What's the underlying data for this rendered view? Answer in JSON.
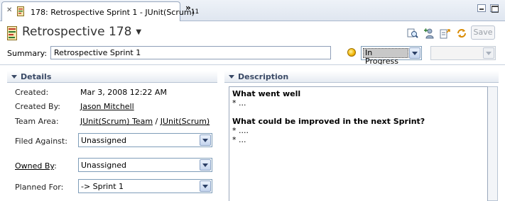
{
  "tab": {
    "title": "178: Retrospective Sprint 1 - JUnit(Scrum)",
    "overflow_count": "11"
  },
  "header": {
    "title": "Retrospective 178",
    "save_label": "Save",
    "summary_label": "Summary:",
    "summary_value": "Retrospective Sprint 1",
    "state_value": "In Progress",
    "resolution_value": ""
  },
  "details": {
    "heading": "Details",
    "fields": [
      {
        "label": "Created:",
        "value": "Mar 3, 2008 12:22 AM"
      },
      {
        "label": "Created By:",
        "value": "Jason Mitchell"
      },
      {
        "label": "Team Area:",
        "value_team": "JUnit(Scrum) Team",
        "separator": "/",
        "value_project": "JUnit(Scrum)"
      },
      {
        "label": "Filed Against:",
        "value": "Unassigned"
      },
      {
        "label": "Owned By",
        "suffix": ":",
        "value": "Unassigned"
      },
      {
        "label": "Planned For:",
        "value": "-> Sprint 1"
      }
    ]
  },
  "description": {
    "heading": "Description",
    "lines": [
      {
        "text": "What went well",
        "bold": true
      },
      {
        "text": "* ...",
        "bold": false
      },
      {
        "text": "",
        "bold": false
      },
      {
        "text": "What could be improved in the next Sprint?",
        "bold": true
      },
      {
        "text": "* ....",
        "bold": false
      },
      {
        "text": "* ...",
        "bold": false
      }
    ]
  },
  "icons": {
    "tab_close": "close-icon",
    "work_item": "work-item-icon",
    "state": "state-in-progress-icon",
    "toolbar": [
      "find-related-icon",
      "add-subscriber-icon",
      "create-link-icon",
      "refresh-icon"
    ]
  },
  "colors": {
    "tab_bar": "#dfe6f0",
    "section_heading": "#3a4a66",
    "state_highlight": "#c8c8c8",
    "state_icon": "#f0b400"
  }
}
